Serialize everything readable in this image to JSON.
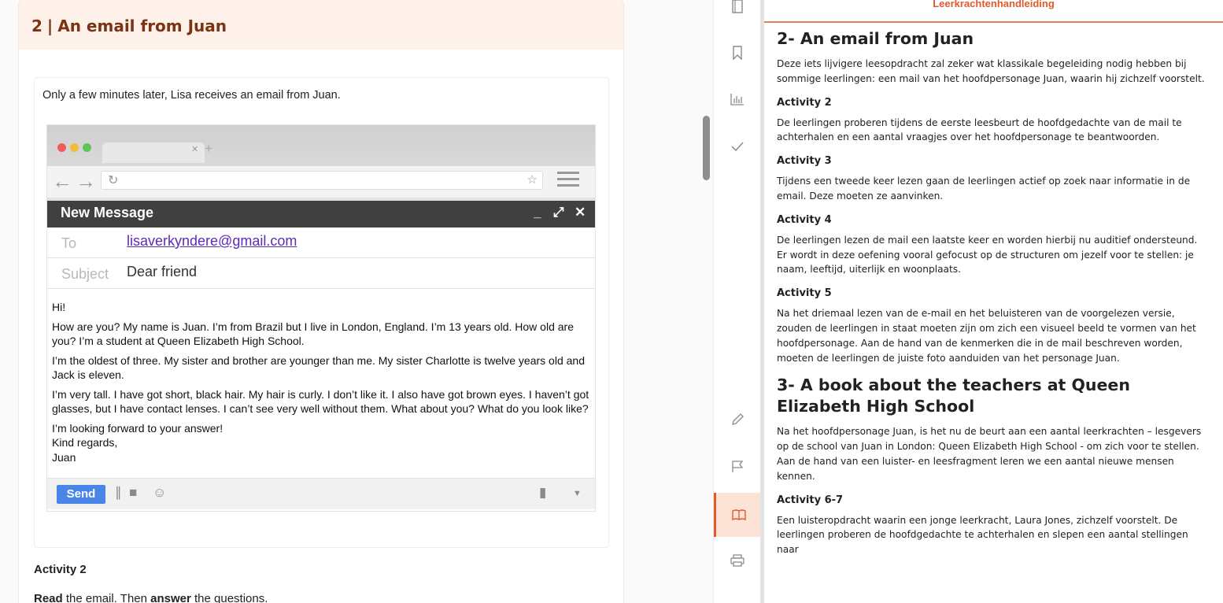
{
  "lesson": {
    "section_number": "2",
    "section_title": "An email from Juan",
    "intro": "Only a few minutes later, Lisa receives an email from Juan.",
    "email": {
      "window_title": "New Message",
      "to_label": "To",
      "to_value": "lisaverkyndere@gmail.com",
      "subject_label": "Subject",
      "subject_value": "Dear friend",
      "greeting": "Hi!",
      "paragraphs": [
        "How are you? My name is Juan. I’m from Brazil but I live in London, England. I’m 13 years old. How old are you? I’m a student at Queen Elizabeth High School.",
        "I’m the oldest of three. My sister and brother are younger than me. My sister Charlotte is twelve years old and Jack is eleven.",
        "I’m very tall. I have got short, black hair. My hair is curly. I don’t like it. I also have got brown eyes. I haven’t got glasses, but I have contact lenses. I can’t see very well without them. What about you? What do you look like?"
      ],
      "closing_1": "I’m looking forward to your answer!",
      "closing_2": "Kind regards,",
      "closing_3": "Juan",
      "send_label": "Send"
    },
    "activity_title": "Activity 2",
    "instruction_1": "Read",
    "instruction_2": " the email. Then ",
    "instruction_3": "answer",
    "instruction_4": " the questions."
  },
  "teacher_panel": {
    "header": "Leerkrachtenhandleiding",
    "section2_title": "2- An email from Juan",
    "section2_intro": "Deze iets lijvigere leesopdracht zal zeker wat klassikale begeleiding nodig hebben bij sommige leerlingen: een mail van het hoofdpersonage Juan, waarin hij zichzelf voorstelt.",
    "activity2_title": "Activity 2",
    "activity2_text": "De leerlingen proberen tijdens de eerste leesbeurt de hoofdgedachte van de mail te achterhalen en een aantal vraagjes over het hoofdpersonage te beantwoorden.",
    "activity3_title": "Activity 3",
    "activity3_text": "Tijdens een tweede keer lezen gaan de leerlingen actief op zoek naar informatie in de email. Deze moeten ze aanvinken.",
    "activity4_title": "Activity 4",
    "activity4_text": "De leerlingen lezen de mail een laatste keer en worden hierbij nu auditief ondersteund. Er wordt in deze oefening vooral gefocust op de structuren om jezelf voor te stellen: je naam, leeftijd, uiterlijk en woonplaats.",
    "activity5_title": "Activity 5",
    "activity5_text": "Na het driemaal lezen van de e-mail en het beluisteren van de voorgelezen versie, zouden de leerlingen in staat moeten zijn om zich een visueel beeld te vormen van het hoofdpersonage. Aan de hand van de kenmerken die in de mail beschreven worden, moeten de leerlingen de juiste foto aanduiden van het personage Juan.",
    "section3_title": "3- A book about the teachers at Queen Elizabeth High School",
    "section3_intro": "Na het hoofdpersonage Juan, is het nu de beurt aan een aantal leerkrachten – lesgevers op de school van Juan in London: Queen Elizabeth High School - om zich voor te stellen. Aan de hand van een luister- en leesfragment leren we een aantal nieuwe mensen kennen.",
    "activity67_title": "Activity 6-7",
    "activity67_text": "Een luisteropdracht waarin een jonge leerkracht, Laura Jones, zichzelf voorstelt. De leerlingen proberen de hoofdgedachte te achterhalen en slepen een aantal stellingen naar"
  },
  "toolbar": {
    "items": [
      "notebook-icon",
      "bookmark-icon",
      "chart-icon",
      "check-icon",
      "pencil-icon",
      "flag-icon",
      "book-open-icon",
      "printer-icon"
    ],
    "active": "book-open-icon",
    "accent_color": "#e2592c"
  }
}
